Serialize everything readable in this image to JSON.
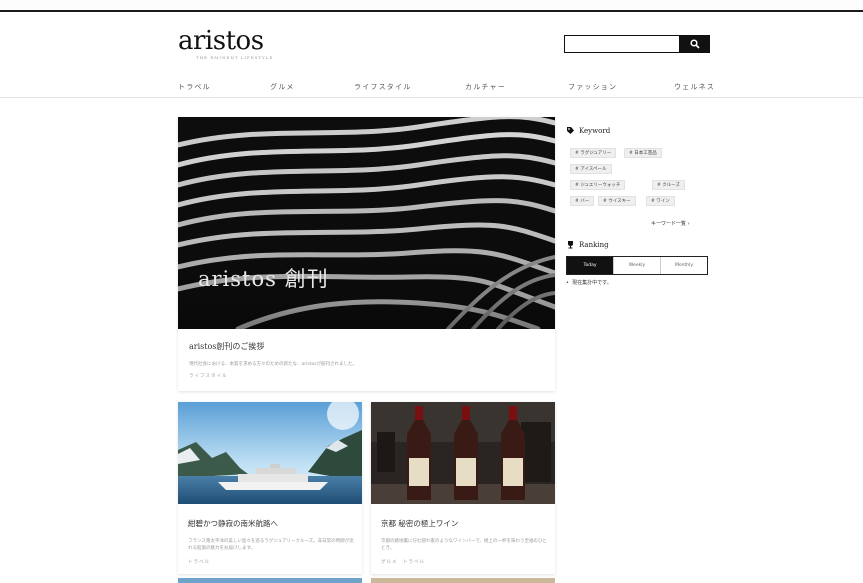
{
  "brand": {
    "name": "aristos",
    "tagline": "THE EMINENT LIFESTYLE"
  },
  "search": {
    "placeholder": "",
    "button_icon": "search-icon"
  },
  "nav": [
    "トラベル",
    "グルメ",
    "ライフスタイル",
    "カルチャー",
    "ファッション",
    "ウェルネス"
  ],
  "feature": {
    "overlay_text": "aristos 創刊",
    "title": "aristos創刊のご挨拶",
    "excerpt": "現代社会における、本質を求める方々のための新たな、aristosが創刊されました。",
    "category": "ライフスタイル"
  },
  "cards": [
    {
      "title": "紺碧かつ静寂の南米航路へ",
      "excerpt": "フランス南太平洋の美しい島々を巡るラグジュアリークルーズ。非日常の時間が流れる船旅の魅力をお届けします。",
      "category": "トラベル"
    },
    {
      "title": "京都 秘密の極上ワイン",
      "excerpt": "京都の路地裏に佇む隠れ家のようなワインバーで、極上の一杯を味わう至福のひととき。",
      "category": "グルメ　トラベル"
    }
  ],
  "sidebar": {
    "keyword_heading": "Keyword",
    "keywords": [
      "ラグジュアリー",
      "日本工芸品",
      "アイスペール",
      "ジュエリーウォッチ",
      "クルーズ",
      "バー",
      "ウイスキー",
      "ワイン"
    ],
    "keyword_all": "キーワード一覧 ›",
    "ranking_heading": "Ranking",
    "ranking_tabs": [
      "Today",
      "Weekly",
      "Monthly"
    ],
    "ranking_note": "現在集計中です。"
  },
  "colors": {
    "accent": "#111111",
    "tag_bg": "#efefef",
    "text_muted": "#999999"
  }
}
